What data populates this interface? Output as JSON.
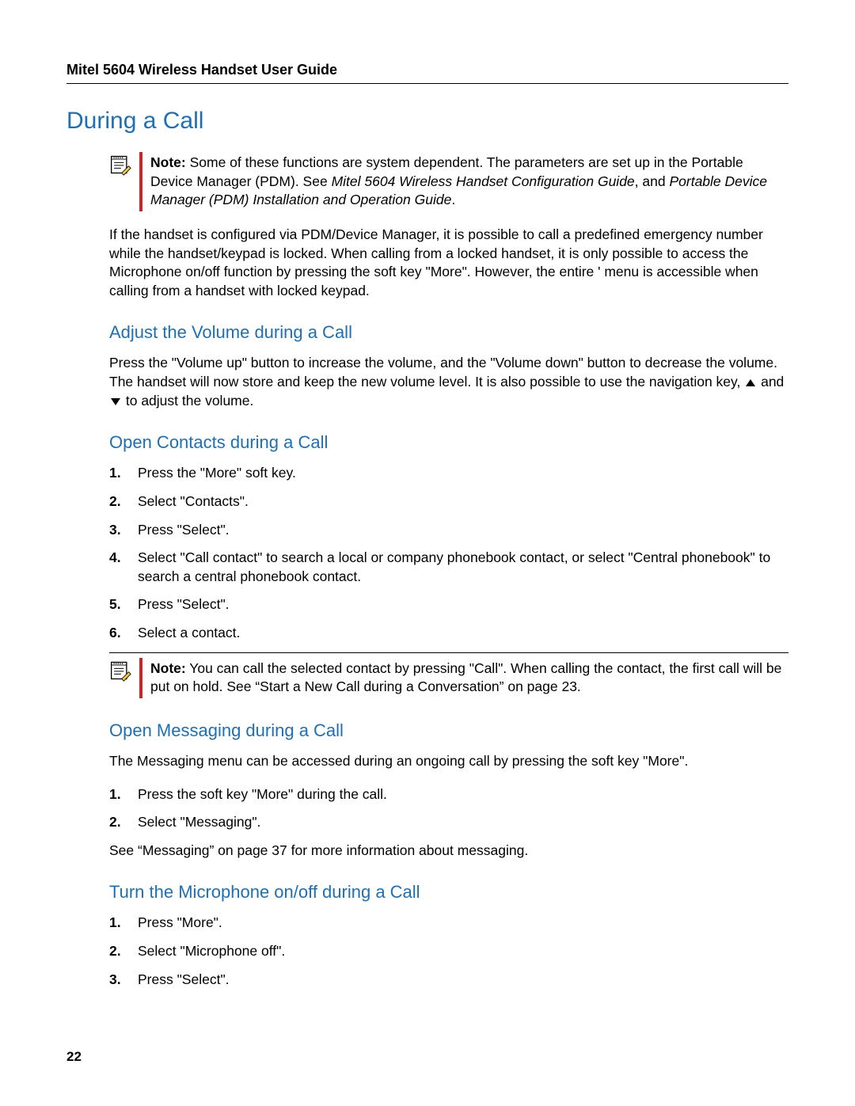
{
  "header": {
    "doc_title": "Mitel 5604 Wireless Handset User Guide"
  },
  "h1": "During a Call",
  "note1": {
    "label": "Note:",
    "t1": " Some of these functions are system dependent. The parameters are set up in the Portable Device Manager (PDM). See ",
    "i1": "Mitel 5604 Wireless Handset Configuration Guide",
    "t2": ", and ",
    "i2": "Portable Device Manager (PDM) Installation and Operation Guide",
    "t3": "."
  },
  "p_locked": "If the handset is configured via PDM/Device Manager, it is possible to call a predefined emergency number while the handset/keypad is locked. When calling from a locked handset, it is only possible to access the Microphone on/off function by pressing the soft key \"More\". However, the entire ' menu is accessible when calling from a handset with locked keypad.",
  "h2_volume": "Adjust the Volume during a Call",
  "p_volume_a": "Press the \"Volume up\" button to increase the volume, and the \"Volume down\" button to decrease the volume. The handset will now store and keep the new volume level. It is also possible to use the navigation key, ",
  "p_volume_b": " and ",
  "p_volume_c": " to adjust the volume.",
  "h2_contacts": "Open Contacts during a Call",
  "contacts_steps": [
    "Press the \"More\" soft key.",
    "Select \"Contacts\".",
    "Press \"Select\".",
    "Select \"Call contact\" to search a local or company phonebook contact, or select \"Central phonebook\" to search a central phonebook contact.",
    "Press \"Select\".",
    "Select a contact."
  ],
  "note2": {
    "label": "Note:",
    "text": " You can call the selected contact by pressing \"Call\". When calling the contact, the first call will be put on hold. See “Start a New Call during a Conversation” on page 23."
  },
  "h2_messaging": "Open Messaging during a Call",
  "p_messaging_intro": "The Messaging menu can be accessed during an ongoing call by pressing the soft key \"More\".",
  "messaging_steps": [
    "Press the soft key \"More\" during the call.",
    "Select \"Messaging\"."
  ],
  "p_messaging_ref": "See “Messaging” on page 37 for more information about messaging.",
  "h2_mic": "Turn the Microphone on/off during a Call",
  "mic_steps": [
    "Press \"More\".",
    "Select \"Microphone off\".",
    "Press \"Select\"."
  ],
  "page_number": "22"
}
